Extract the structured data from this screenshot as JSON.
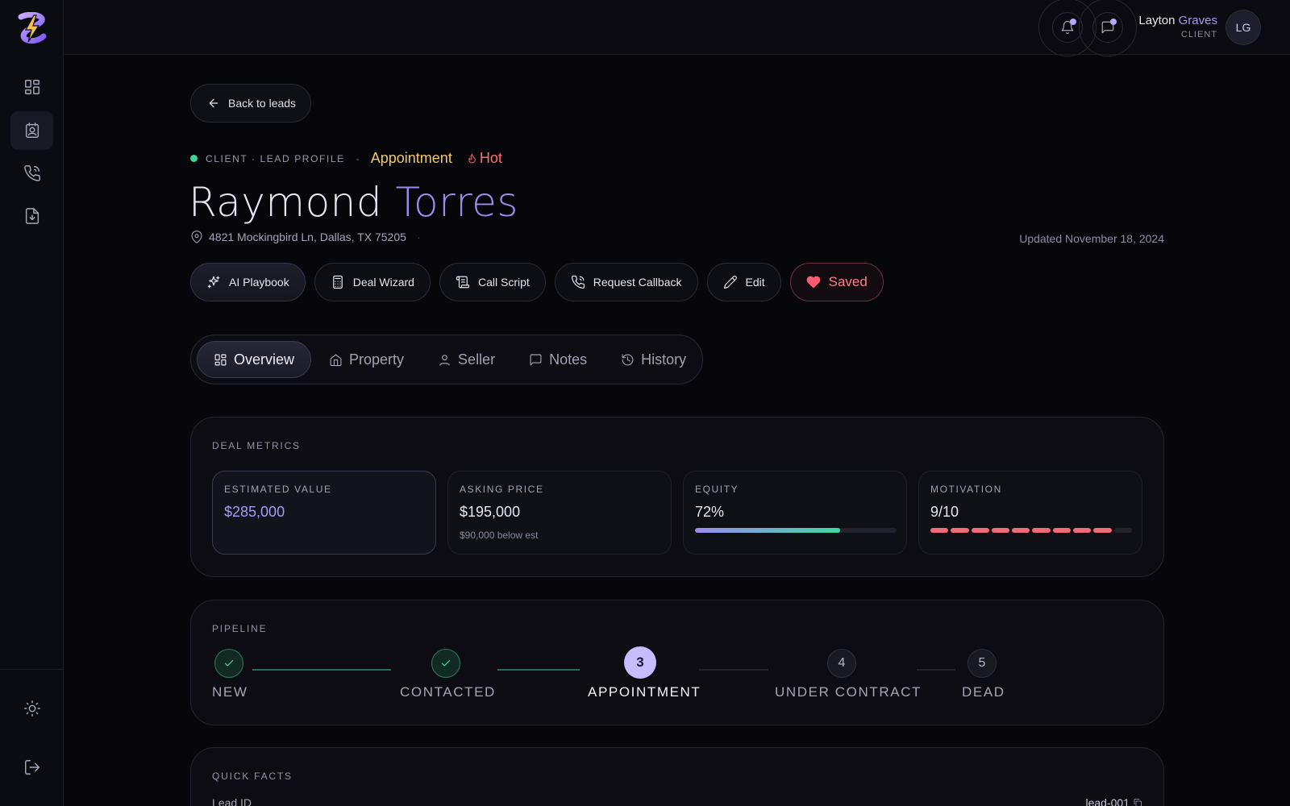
{
  "colors": {
    "accent": "#9d8cf0",
    "hot": "#ff6b6b",
    "status": "#f3c76a",
    "success": "#3dd598"
  },
  "sidebar": {
    "items": [
      {
        "icon": "dashboard-icon"
      },
      {
        "icon": "contact-card-icon"
      },
      {
        "icon": "phone-icon"
      },
      {
        "icon": "download-file-icon"
      }
    ],
    "bottom": [
      {
        "icon": "sun-icon"
      },
      {
        "icon": "logout-icon"
      }
    ]
  },
  "topbar": {
    "user_first": "Layton",
    "user_last": "Graves",
    "user_role": "CLIENT",
    "avatar_initials": "LG"
  },
  "back_label": "Back to leads",
  "lead": {
    "eyebrow": "CLIENT · LEAD PROFILE",
    "separator": "-",
    "status": "Appointment",
    "temperature": "Hot",
    "first_name": "Raymond",
    "last_name": "Torres",
    "address": "4821 Mockingbird Ln, Dallas, TX 75205",
    "address_suffix": "·",
    "updated": "Updated November 18, 2024"
  },
  "actions": [
    {
      "label": "AI Playbook",
      "icon": "sparkles-icon"
    },
    {
      "label": "Deal Wizard",
      "icon": "calculator-icon"
    },
    {
      "label": "Call Script",
      "icon": "script-icon"
    },
    {
      "label": "Request Callback",
      "icon": "phone-callback-icon"
    },
    {
      "label": "Edit",
      "icon": "pencil-icon"
    },
    {
      "label": "Saved",
      "icon": "heart-icon"
    }
  ],
  "tabs": [
    {
      "label": "Overview",
      "icon": "grid-icon",
      "active": true
    },
    {
      "label": "Property",
      "icon": "home-icon"
    },
    {
      "label": "Seller",
      "icon": "user-icon"
    },
    {
      "label": "Notes",
      "icon": "message-icon"
    },
    {
      "label": "History",
      "icon": "history-icon"
    }
  ],
  "deal_metrics": {
    "title": "DEAL METRICS",
    "estimated_value": {
      "label": "ESTIMATED VALUE",
      "value": "$285,000"
    },
    "asking_price": {
      "label": "ASKING PRICE",
      "value": "$195,000",
      "sub": "$90,000 below est"
    },
    "equity": {
      "label": "EQUITY",
      "value": "72%",
      "percent": 72
    },
    "motivation": {
      "label": "MOTIVATION",
      "value": "9/10",
      "score": 9,
      "max": 10
    }
  },
  "pipeline": {
    "title": "PIPELINE",
    "current_step": 3,
    "steps": [
      {
        "number": "1",
        "label": "NEW",
        "state": "done"
      },
      {
        "number": "2",
        "label": "CONTACTED",
        "state": "done"
      },
      {
        "number": "3",
        "label": "APPOINTMENT",
        "state": "current"
      },
      {
        "number": "4",
        "label": "UNDER CONTRACT",
        "state": "todo"
      },
      {
        "number": "5",
        "label": "DEAD",
        "state": "todo"
      }
    ]
  },
  "quick_facts": {
    "title": "QUICK FACTS",
    "rows": [
      {
        "label": "Lead ID",
        "value": "lead-001"
      }
    ]
  }
}
